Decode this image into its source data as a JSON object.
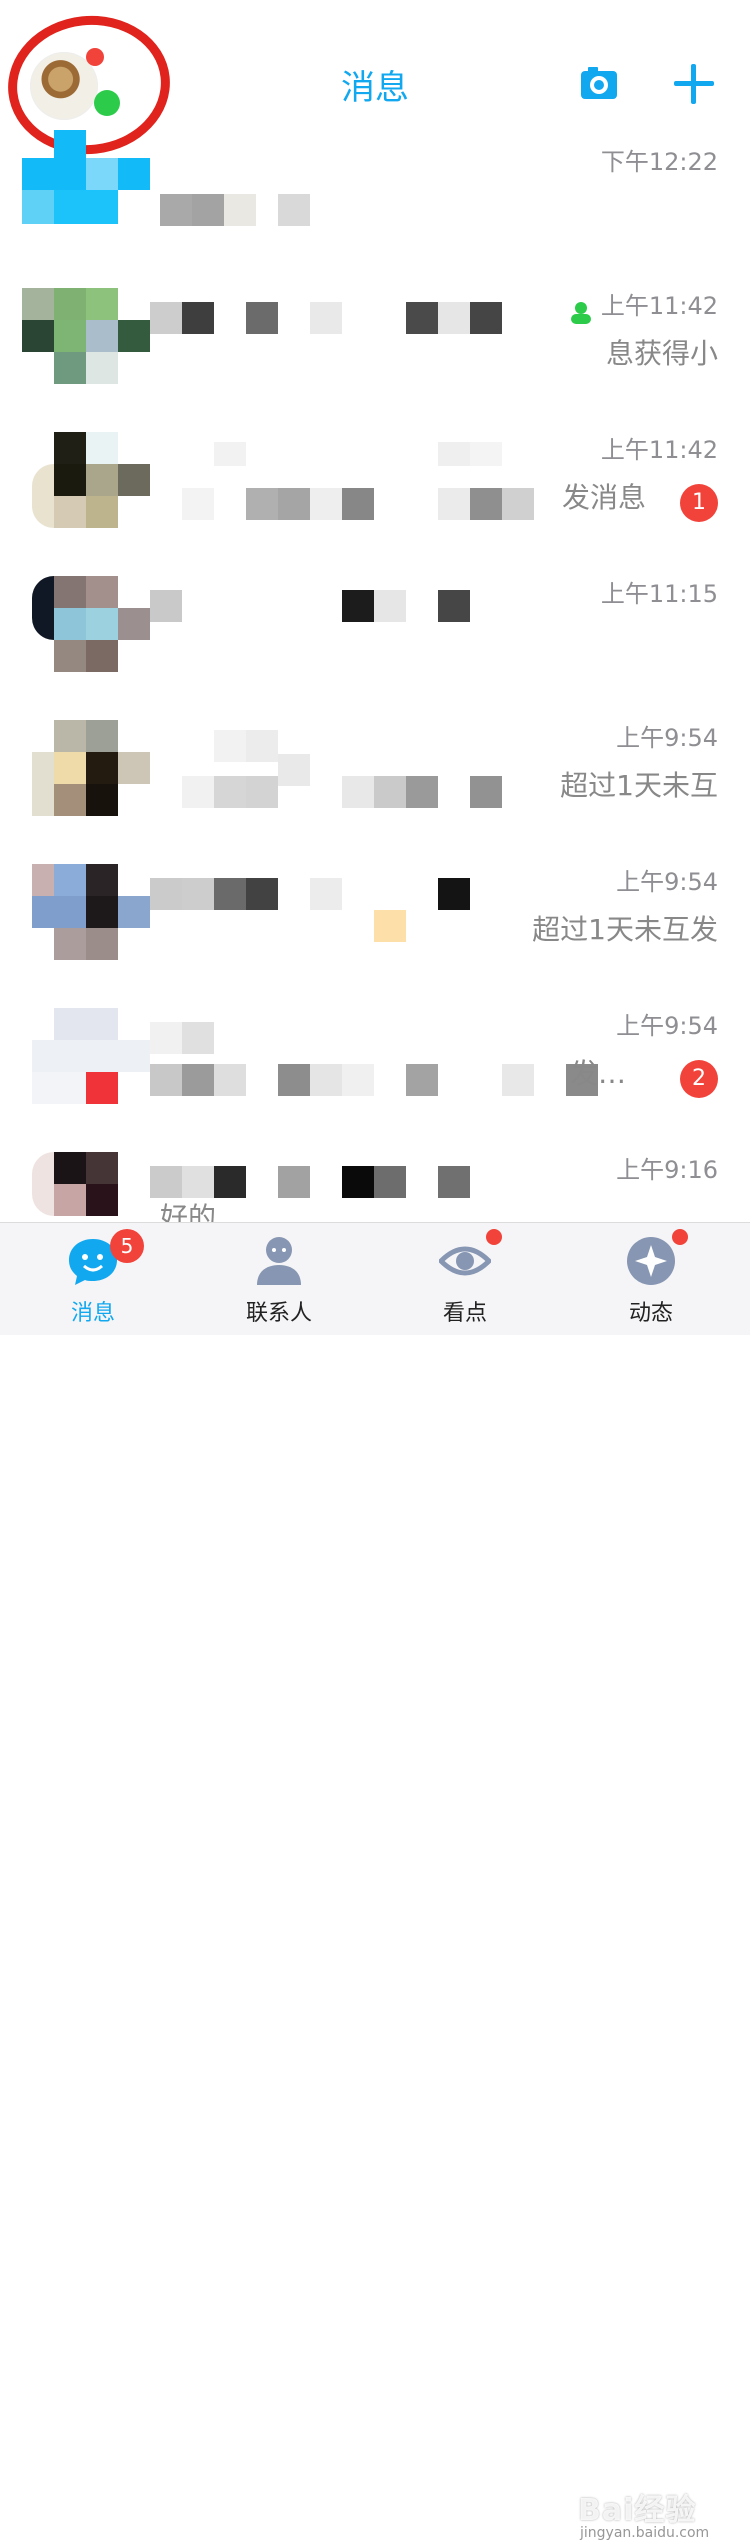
{
  "header": {
    "title": "消息"
  },
  "conversations": [
    {
      "time": "下午12:22",
      "preview": "",
      "badge": ""
    },
    {
      "time": "上午11:42",
      "preview": "息获得小",
      "badge": ""
    },
    {
      "time": "上午11:42",
      "preview": "发消息",
      "badge": "1"
    },
    {
      "time": "上午11:15",
      "preview": "",
      "badge": ""
    },
    {
      "time": "上午9:54",
      "preview": "超过1天未互",
      "badge": ""
    },
    {
      "time": "上午9:54",
      "preview": "超过1天未互发",
      "badge": ""
    },
    {
      "time": "上午9:54",
      "preview": "发…",
      "badge": "2"
    },
    {
      "time": "上午9:16",
      "preview": "好的",
      "badge": ""
    }
  ],
  "tabbar": {
    "tabs": [
      {
        "label": "消息",
        "badge": "5"
      },
      {
        "label": "联系人"
      },
      {
        "label": "看点"
      },
      {
        "label": "动态"
      }
    ]
  },
  "watermark": {
    "text": "Bai经验",
    "sub": "jingyan.baidu.com"
  },
  "colors": {
    "accent": "#12a8f0",
    "badge": "#f2433a",
    "online": "#2ccb4a"
  }
}
